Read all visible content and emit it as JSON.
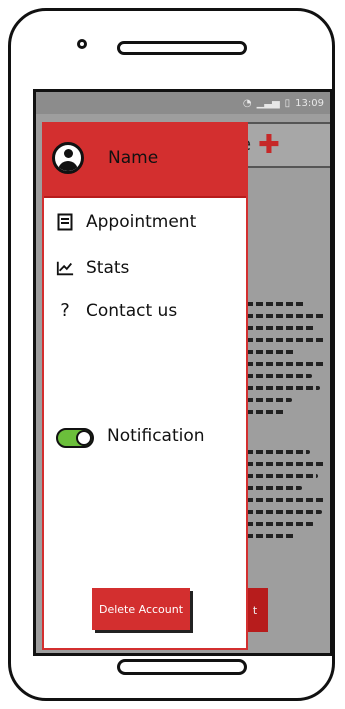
{
  "statusbar": {
    "wifi_icon": "wifi-icon",
    "signal_icon": "signal-icon",
    "battery_icon": "battery-icon",
    "time": "13:09"
  },
  "background_screen": {
    "title_fragment": "e",
    "plus_icon": "plus-icon",
    "button_fragment": "t"
  },
  "drawer": {
    "header": {
      "avatar_icon": "user-avatar-icon",
      "name": "Name"
    },
    "items": [
      {
        "icon": "book-icon",
        "label": "Appointment"
      },
      {
        "icon": "trend-chart-icon",
        "label": "Stats"
      },
      {
        "icon": "question-icon",
        "label": "Contact us"
      }
    ],
    "notification": {
      "label": "Notification",
      "enabled": true
    },
    "delete_button": "Delete Account"
  },
  "colors": {
    "accent": "#d32f2f",
    "toggle_on": "#6bbf3b",
    "screen_dim": "#9e9e9e"
  }
}
